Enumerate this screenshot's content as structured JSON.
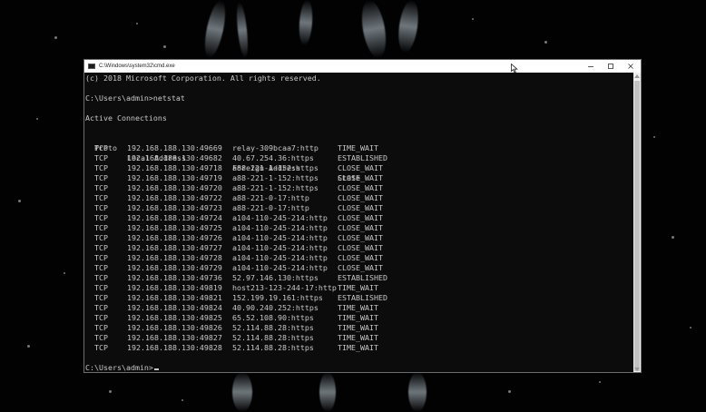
{
  "window": {
    "title": "C:\\Windows\\system32\\cmd.exe",
    "controls": {
      "minimize_icon": "minimize-icon",
      "maximize_icon": "maximize-icon",
      "close_icon": "close-icon"
    }
  },
  "console": {
    "copyright": "(c) 2018 Microsoft Corporation. All rights reserved.",
    "command_line": "C:\\Users\\admin>netstat",
    "section_title": "Active Connections",
    "headers": {
      "proto": "Proto",
      "local": "Local Address",
      "foreign": "Foreign Address",
      "state": "State"
    },
    "rows": [
      {
        "proto": "TCP",
        "local": "192.168.188.130:49669",
        "foreign": "relay-309bcaa7:http",
        "state": "TIME_WAIT"
      },
      {
        "proto": "TCP",
        "local": "192.168.188.130:49682",
        "foreign": "40.67.254.36:https",
        "state": "ESTABLISHED"
      },
      {
        "proto": "TCP",
        "local": "192.168.188.130:49718",
        "foreign": "a88-221-1-152:https",
        "state": "CLOSE_WAIT"
      },
      {
        "proto": "TCP",
        "local": "192.168.188.130:49719",
        "foreign": "a88-221-1-152:https",
        "state": "CLOSE_WAIT"
      },
      {
        "proto": "TCP",
        "local": "192.168.188.130:49720",
        "foreign": "a88-221-1-152:https",
        "state": "CLOSE_WAIT"
      },
      {
        "proto": "TCP",
        "local": "192.168.188.130:49722",
        "foreign": "a88-221-0-17:http",
        "state": "CLOSE_WAIT"
      },
      {
        "proto": "TCP",
        "local": "192.168.188.130:49723",
        "foreign": "a88-221-0-17:http",
        "state": "CLOSE_WAIT"
      },
      {
        "proto": "TCP",
        "local": "192.168.188.130:49724",
        "foreign": "a104-110-245-214:http",
        "state": "CLOSE_WAIT"
      },
      {
        "proto": "TCP",
        "local": "192.168.188.130:49725",
        "foreign": "a104-110-245-214:http",
        "state": "CLOSE_WAIT"
      },
      {
        "proto": "TCP",
        "local": "192.168.188.130:49726",
        "foreign": "a104-110-245-214:http",
        "state": "CLOSE_WAIT"
      },
      {
        "proto": "TCP",
        "local": "192.168.188.130:49727",
        "foreign": "a104-110-245-214:http",
        "state": "CLOSE_WAIT"
      },
      {
        "proto": "TCP",
        "local": "192.168.188.130:49728",
        "foreign": "a104-110-245-214:http",
        "state": "CLOSE_WAIT"
      },
      {
        "proto": "TCP",
        "local": "192.168.188.130:49729",
        "foreign": "a104-110-245-214:http",
        "state": "CLOSE_WAIT"
      },
      {
        "proto": "TCP",
        "local": "192.168.188.130:49736",
        "foreign": "52.97.146.130:https",
        "state": "ESTABLISHED"
      },
      {
        "proto": "TCP",
        "local": "192.168.188.130:49819",
        "foreign": "host213-123-244-17:http",
        "state": "TIME_WAIT"
      },
      {
        "proto": "TCP",
        "local": "192.168.188.130:49821",
        "foreign": "152.199.19.161:https",
        "state": "ESTABLISHED"
      },
      {
        "proto": "TCP",
        "local": "192.168.188.130:49824",
        "foreign": "40.90.240.252:https",
        "state": "TIME_WAIT"
      },
      {
        "proto": "TCP",
        "local": "192.168.188.130:49825",
        "foreign": "65.52.108.90:https",
        "state": "TIME_WAIT"
      },
      {
        "proto": "TCP",
        "local": "192.168.188.130:49826",
        "foreign": "52.114.88.28:https",
        "state": "TIME_WAIT"
      },
      {
        "proto": "TCP",
        "local": "192.168.188.130:49827",
        "foreign": "52.114.88.28:https",
        "state": "TIME_WAIT"
      },
      {
        "proto": "TCP",
        "local": "192.168.188.130:49828",
        "foreign": "52.114.88.28:https",
        "state": "TIME_WAIT"
      }
    ],
    "prompt": "C:\\Users\\admin>"
  },
  "colors": {
    "console_bg": "#0c0c0c",
    "console_text": "#c8c8c8",
    "titlebar_bg": "#ffffff"
  },
  "icons": {
    "app": "cmd-app-icon",
    "pointer": "mouse-pointer-icon"
  }
}
